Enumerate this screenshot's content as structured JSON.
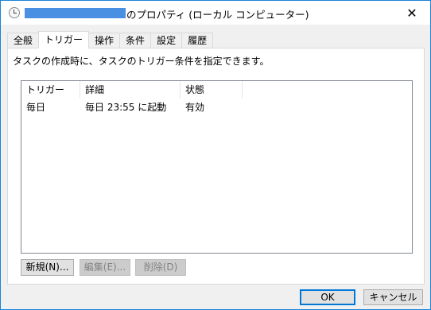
{
  "window": {
    "title": "のプロパティ (ローカル コンピューター)",
    "close_icon": "close-icon"
  },
  "tabs": [
    {
      "label": "全般"
    },
    {
      "label": "トリガー",
      "active": true
    },
    {
      "label": "操作"
    },
    {
      "label": "条件"
    },
    {
      "label": "設定"
    },
    {
      "label": "履歴"
    }
  ],
  "panel": {
    "description": "タスクの作成時に、タスクのトリガー条件を指定できます。",
    "columns": [
      "トリガー",
      "詳細",
      "状態"
    ],
    "rows": [
      {
        "trigger": "毎日",
        "detail": "毎日 23:55 に起動",
        "status": "有効"
      }
    ],
    "buttons": {
      "new": "新規(N)...",
      "edit": "編集(E)...",
      "delete": "削除(D)"
    }
  },
  "footer": {
    "ok": "OK",
    "cancel": "キャンセル"
  },
  "colors": {
    "accent": "#0078d7",
    "redaction": "#4a90e2"
  }
}
